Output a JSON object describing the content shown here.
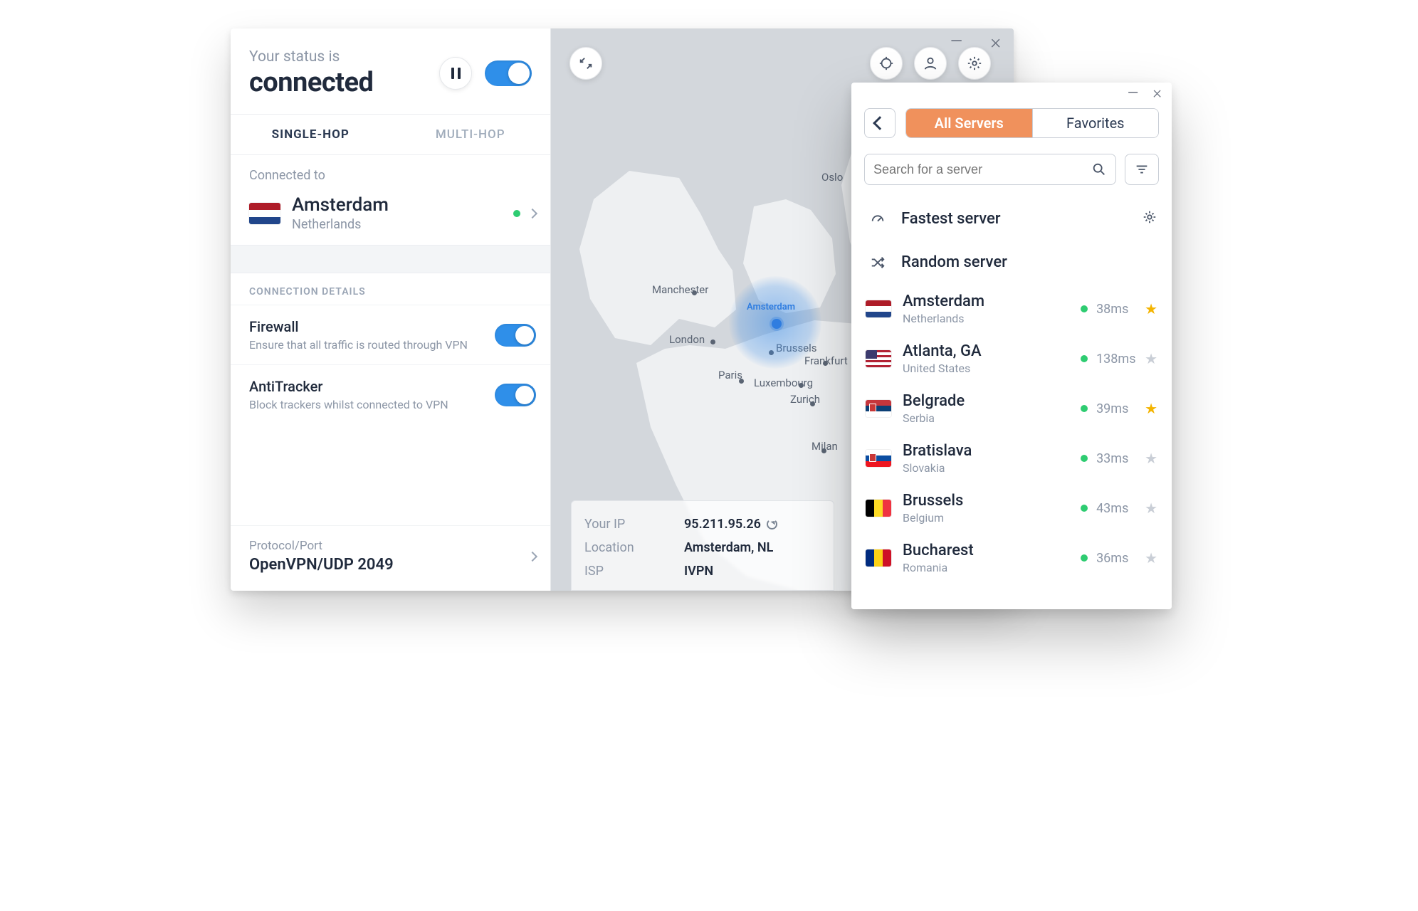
{
  "status": {
    "prefix": "Your status is",
    "state": "connected"
  },
  "tabs": {
    "single": "SINGLE-HOP",
    "multi": "MULTI-HOP"
  },
  "connection": {
    "label": "Connected to",
    "city": "Amsterdam",
    "country": "Netherlands"
  },
  "details": {
    "header": "CONNECTION DETAILS",
    "firewall": {
      "title": "Firewall",
      "sub": "Ensure that all traffic is routed through VPN"
    },
    "antitracker": {
      "title": "AntiTracker",
      "sub": "Block trackers whilst connected to VPN"
    },
    "protocol": {
      "label": "Protocol/Port",
      "value": "OpenVPN/UDP 2049"
    }
  },
  "ip_card": {
    "ip_label": "Your IP",
    "ip": "95.211.95.26",
    "loc_label": "Location",
    "loc": "Amsterdam, NL",
    "isp_label": "ISP",
    "isp": "IVPN"
  },
  "map_cities": {
    "manchester": "Manchester",
    "london": "London",
    "amsterdam": "Amsterdam",
    "brussels": "Brussels",
    "paris": "Paris",
    "luxembourg": "Luxembourg",
    "frankfurt": "Frankfurt",
    "zurich": "Zurich",
    "milan": "Milan",
    "oslo": "Oslo"
  },
  "server_popup": {
    "seg": {
      "all": "All Servers",
      "fav": "Favorites"
    },
    "search_placeholder": "Search for a server",
    "fastest": "Fastest server",
    "random": "Random server",
    "servers": [
      {
        "city": "Amsterdam",
        "country": "Netherlands",
        "ms": "38ms",
        "fav": true,
        "flag": [
          "#ae1c28",
          "#ffffff",
          "#21468b"
        ]
      },
      {
        "city": "Atlanta, GA",
        "country": "United States",
        "ms": "138ms",
        "fav": false,
        "flag_us": true
      },
      {
        "city": "Belgrade",
        "country": "Serbia",
        "ms": "39ms",
        "fav": true,
        "flag": [
          "#c6363c",
          "#0c4076",
          "#ffffff"
        ],
        "emblem": true
      },
      {
        "city": "Bratislava",
        "country": "Slovakia",
        "ms": "33ms",
        "fav": false,
        "flag": [
          "#ffffff",
          "#0b4ea2",
          "#ee1620"
        ],
        "emblem": true
      },
      {
        "city": "Brussels",
        "country": "Belgium",
        "ms": "43ms",
        "fav": false,
        "flag_vert": [
          "#000000",
          "#fdda24",
          "#ef3340"
        ]
      },
      {
        "city": "Bucharest",
        "country": "Romania",
        "ms": "36ms",
        "fav": false,
        "flag_vert": [
          "#002b7f",
          "#fcd116",
          "#ce1126"
        ]
      }
    ]
  }
}
